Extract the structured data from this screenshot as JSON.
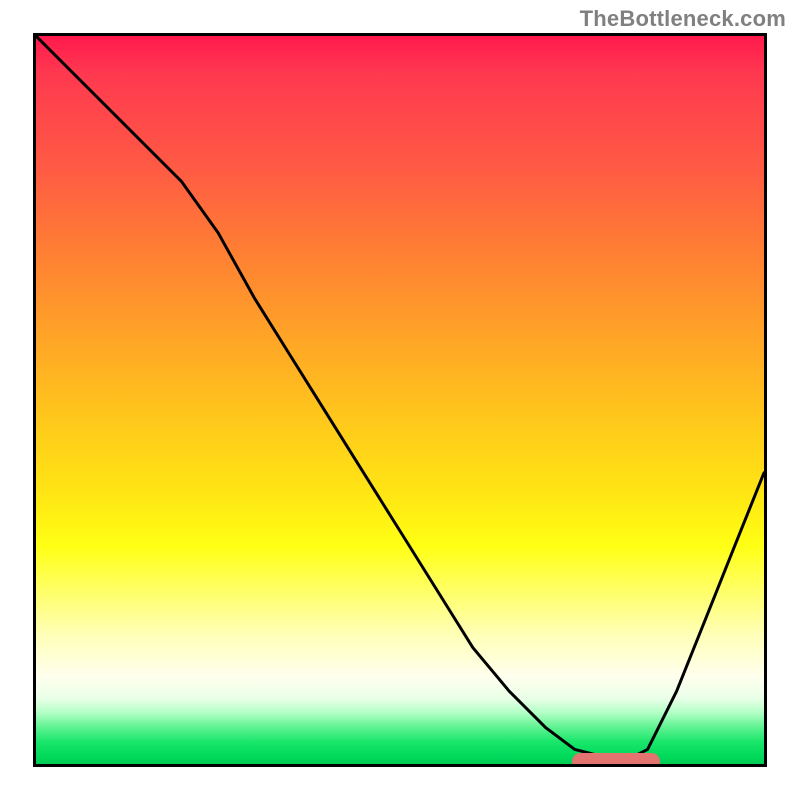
{
  "watermark": "TheBottleneck.com",
  "chart_data": {
    "type": "line",
    "title": "",
    "xlabel": "",
    "ylabel": "",
    "xlim": [
      0,
      100
    ],
    "ylim": [
      0,
      100
    ],
    "background_gradient": {
      "direction": "vertical",
      "stops": [
        {
          "pos": 0,
          "color": "#ff1a4d",
          "meaning": "high-bottleneck"
        },
        {
          "pos": 50,
          "color": "#ffcc1a",
          "meaning": "medium"
        },
        {
          "pos": 100,
          "color": "#00cc52",
          "meaning": "optimal"
        }
      ]
    },
    "series": [
      {
        "name": "bottleneck-curve",
        "color": "#000000",
        "x": [
          0,
          5,
          10,
          15,
          20,
          25,
          30,
          35,
          40,
          45,
          50,
          55,
          60,
          65,
          70,
          74,
          78,
          82,
          84,
          88,
          92,
          96,
          100
        ],
        "y": [
          100,
          95,
          90,
          85,
          80,
          73,
          64,
          56,
          48,
          40,
          32,
          24,
          16,
          10,
          5,
          2,
          1,
          1,
          2,
          10,
          20,
          30,
          40
        ]
      }
    ],
    "marker": {
      "name": "optimal-range",
      "color": "#e2736f",
      "x_start": 73,
      "x_end": 85,
      "y": 1
    }
  }
}
